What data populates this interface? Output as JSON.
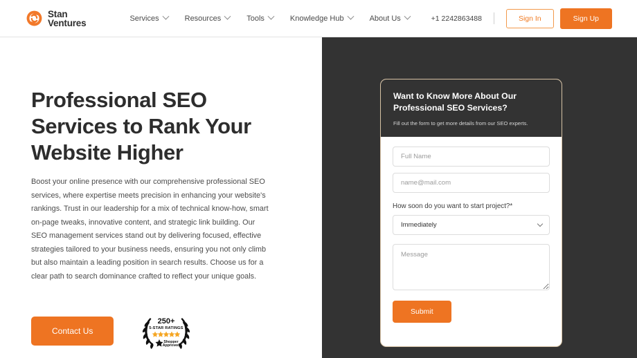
{
  "header": {
    "logo_icon": "stan-ventures-swirl-logo",
    "brand_line1": "Stan",
    "brand_line2": "Ventures",
    "nav": [
      {
        "label": "Services",
        "has_dropdown": true
      },
      {
        "label": "Resources",
        "has_dropdown": true
      },
      {
        "label": "Tools",
        "has_dropdown": true
      },
      {
        "label": "Knowledge Hub",
        "has_dropdown": true
      },
      {
        "label": "About Us",
        "has_dropdown": true
      }
    ],
    "phone": "+1 2242863488",
    "sign_in_label": "Sign In",
    "sign_up_label": "Sign Up"
  },
  "hero": {
    "title": "Professional SEO Services to Rank Your Website Higher",
    "paragraph": "Boost your online presence with our comprehensive professional SEO services, where expertise meets precision in enhancing your website's rankings. Trust in our leadership for a mix of technical know-how, smart on-page tweaks, innovative content, and strategic link building. Our SEO management services stand out by delivering focused, effective strategies tailored to your business needs, ensuring you not only climb but also maintain a leading position in search results. Choose us for a clear path to search dominance crafted to reflect your unique goals.",
    "cta_label": "Contact Us",
    "badge": {
      "count": "250+",
      "caption": "5-STAR RATINGS",
      "stars": 5,
      "brand_line1": "Shopper",
      "brand_line2": "Approved"
    }
  },
  "form": {
    "title": "Want to Know More About Our Professional SEO Services?",
    "subtitle": "Fill out the form to get more details from our SEO experts.",
    "name_placeholder": "Full Name",
    "email_placeholder": "name@mail.com",
    "timeline_label": "How soon do you want to start project?*",
    "timeline_value": "Immediately",
    "timeline_options": [
      "Immediately"
    ],
    "message_placeholder": "Message",
    "submit_label": "Submit"
  },
  "colors": {
    "accent_orange": "#ee7422",
    "dark_panel": "#333333",
    "card_border": "#d8c3a5",
    "heading": "#2d2d2d"
  }
}
